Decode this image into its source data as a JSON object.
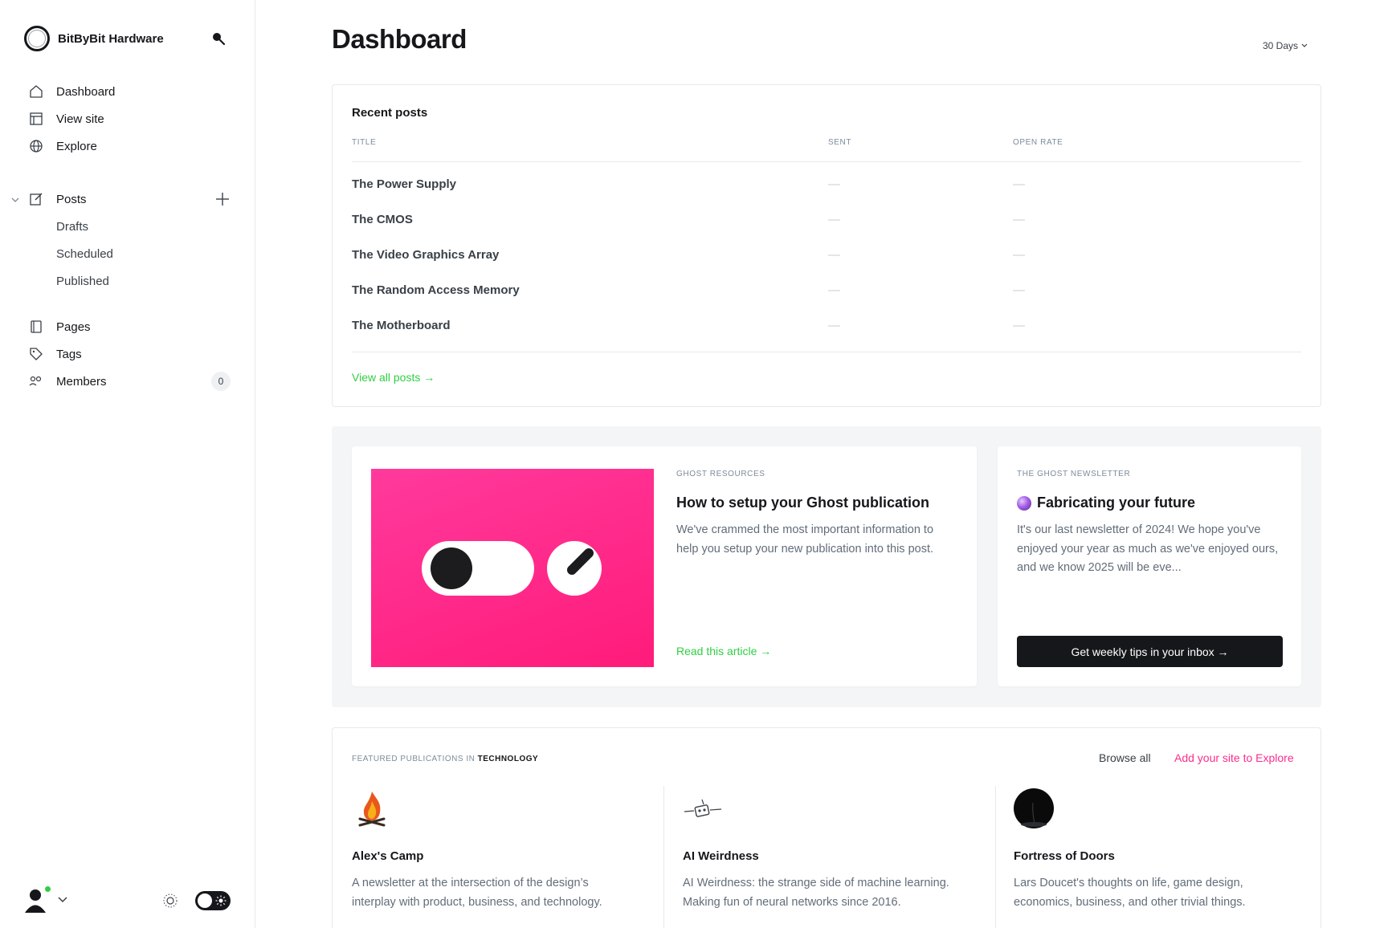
{
  "site": {
    "name": "BitByBit Hardware"
  },
  "sidebar": {
    "primary": [
      {
        "label": "Dashboard",
        "icon": "home-icon"
      },
      {
        "label": "View site",
        "icon": "layout-icon"
      },
      {
        "label": "Explore",
        "icon": "globe-icon"
      }
    ],
    "posts": {
      "label": "Posts",
      "icon": "edit-icon"
    },
    "post_subitems": [
      "Drafts",
      "Scheduled",
      "Published"
    ],
    "secondary": [
      {
        "label": "Pages",
        "icon": "pages-icon"
      },
      {
        "label": "Tags",
        "icon": "tag-icon"
      },
      {
        "label": "Members",
        "icon": "members-icon",
        "count": "0"
      }
    ]
  },
  "header": {
    "title": "Dashboard",
    "range": "30 Days"
  },
  "recent_posts": {
    "title": "Recent posts",
    "columns": [
      "Title",
      "Sent",
      "Open rate"
    ],
    "rows": [
      {
        "title": "The Power Supply",
        "sent": "—",
        "open_rate": "—"
      },
      {
        "title": "The CMOS",
        "sent": "—",
        "open_rate": "—"
      },
      {
        "title": "The Video Graphics Array",
        "sent": "—",
        "open_rate": "—"
      },
      {
        "title": "The Random Access Memory",
        "sent": "—",
        "open_rate": "—"
      },
      {
        "title": "The Motherboard",
        "sent": "—",
        "open_rate": "—"
      }
    ],
    "view_all": "View all posts →"
  },
  "resources": {
    "eyebrow": "Ghost resources",
    "heading": "How to setup your Ghost publication",
    "description": "We've crammed the most important information to help you setup your new publication into this post.",
    "link": "Read this article →"
  },
  "newsletter": {
    "eyebrow": "The Ghost Newsletter",
    "heading": "Fabricating your future",
    "description": "It's our last newsletter of 2024! We hope you've enjoyed your year as much as we've enjoyed ours, and we know 2025 will be eve...",
    "button": "Get weekly tips in your inbox →"
  },
  "featured": {
    "eyebrow_prefix": "FEATURED PUBLICATIONS IN",
    "category": "TECHNOLOGY",
    "browse_all": "Browse all",
    "add_site": "Add your site to Explore",
    "publications": [
      {
        "name": "Alex's Camp",
        "description": "A newsletter at the intersection of the design’s interplay with product, business, and technology."
      },
      {
        "name": "AI Weirdness",
        "description": "AI Weirdness: the strange side of machine learning. Making fun of neural networks since 2016."
      },
      {
        "name": "Fortress of Doors",
        "description": "Lars Doucet's thoughts on life, game design, economics, business, and other trivial things."
      }
    ]
  },
  "colors": {
    "accent_green": "#30cf43",
    "accent_pink": "#fb2d8d",
    "dark": "#15171a"
  }
}
